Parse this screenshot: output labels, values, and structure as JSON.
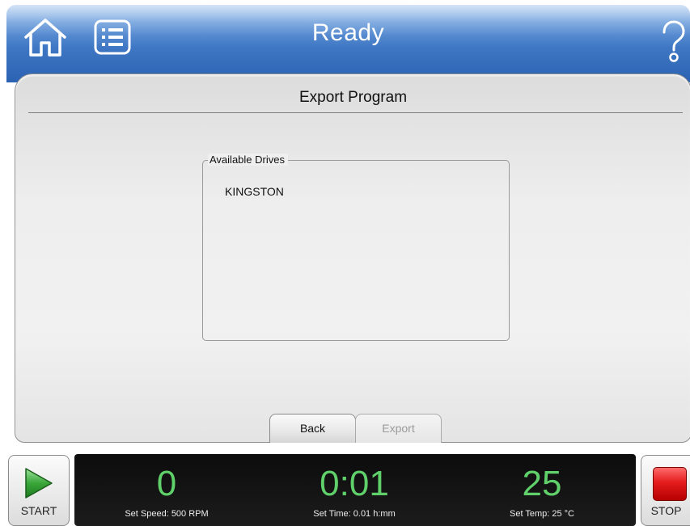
{
  "header": {
    "title": "Ready",
    "home_icon": "home-icon",
    "menu_icon": "list-menu-icon",
    "help_icon": "question-mark-icon"
  },
  "panel": {
    "title": "Export Program",
    "drives_legend": "Available Drives",
    "drives": [
      "KINGSTON"
    ]
  },
  "buttons": {
    "back_label": "Back",
    "export_label": "Export"
  },
  "status": {
    "start_label": "START",
    "stop_label": "STOP",
    "speed_value": "0",
    "speed_set": "Set Speed: 500 RPM",
    "time_value": "0:01",
    "time_set": "Set Time: 0.01 h:mm",
    "temp_value": "25",
    "temp_set": "Set Temp: 25 °C"
  },
  "colors": {
    "header_blue": "#2b62b2",
    "readout_green": "#5fd06a",
    "stop_red": "#e41c1c",
    "start_green": "#3aa63a"
  }
}
